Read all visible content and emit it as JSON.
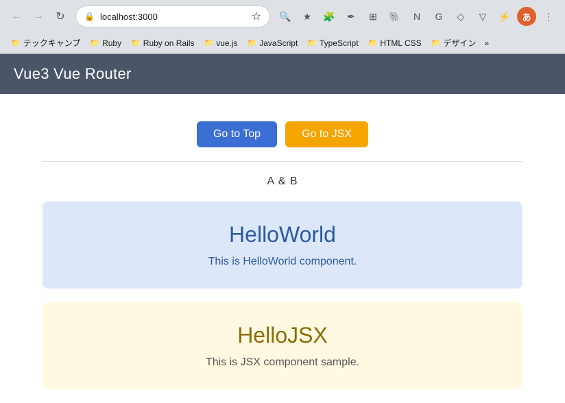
{
  "browser": {
    "url": "localhost:3000",
    "back_disabled": true,
    "forward_disabled": true
  },
  "bookmarks": [
    {
      "label": "テックキャンプ",
      "icon": "📁"
    },
    {
      "label": "Ruby",
      "icon": "📁"
    },
    {
      "label": "Ruby on Rails",
      "icon": "📁"
    },
    {
      "label": "vue.js",
      "icon": "📁"
    },
    {
      "label": "JavaScript",
      "icon": "📁"
    },
    {
      "label": "TypeScript",
      "icon": "📁"
    },
    {
      "label": "HTML CSS",
      "icon": "📁"
    },
    {
      "label": "デザイン",
      "icon": "📁"
    }
  ],
  "header": {
    "title": "Vue3 Vue Router"
  },
  "buttons": {
    "go_to_top": "Go to Top",
    "go_to_jsx": "Go to JSX"
  },
  "route_label": "A & B",
  "hello_world": {
    "title": "HelloWorld",
    "description": "This is HelloWorld component."
  },
  "hello_jsx": {
    "title": "HelloJSX",
    "description": "This is JSX component sample."
  }
}
